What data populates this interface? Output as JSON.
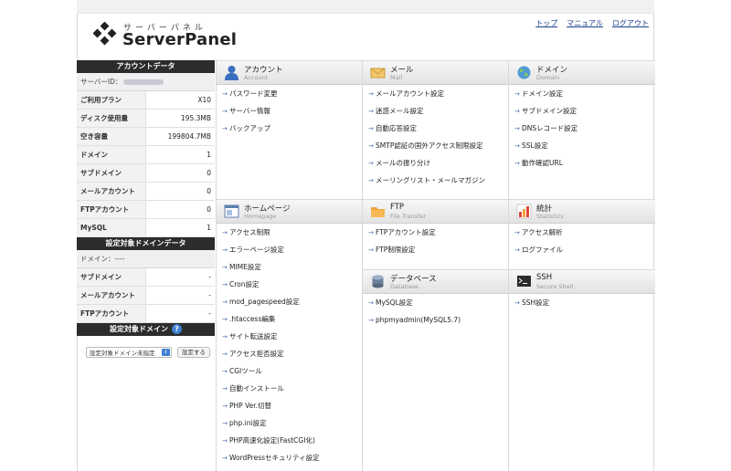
{
  "brand": {
    "kana": "サーバーパネル",
    "name": "ServerPanel"
  },
  "top_links": [
    "トップ",
    "マニュアル",
    "ログアウト"
  ],
  "account_data": {
    "title": "アカウントデータ",
    "server_id_label": "サーバーID：",
    "rows": [
      {
        "label": "ご利用プラン",
        "value": "X10"
      },
      {
        "label": "ディスク使用量",
        "value": "195.3MB"
      },
      {
        "label": "空き容量",
        "value": "199804.7MB"
      },
      {
        "label": "ドメイン",
        "value": "1"
      },
      {
        "label": "サブドメイン",
        "value": "0"
      },
      {
        "label": "メールアカウント",
        "value": "0"
      },
      {
        "label": "FTPアカウント",
        "value": "0"
      },
      {
        "label": "MySQL",
        "value": "1"
      }
    ]
  },
  "domain_data": {
    "title": "設定対象ドメインデータ",
    "domain_label": "ドメイン：----",
    "rows": [
      {
        "label": "サブドメイン",
        "value": "-"
      },
      {
        "label": "メールアカウント",
        "value": "-"
      },
      {
        "label": "FTPアカウント",
        "value": "-"
      }
    ]
  },
  "domain_select": {
    "title": "設定対象ドメイン",
    "help": "?",
    "selected": "設定対象ドメイン未指定",
    "button": "設定する"
  },
  "sections": {
    "account": {
      "title": "アカウント",
      "sub": "Account",
      "items": [
        "パスワード変更",
        "サーバー情報",
        "バックアップ"
      ]
    },
    "mail": {
      "title": "メール",
      "sub": "Mail",
      "items": [
        "メールアカウント設定",
        "迷惑メール設定",
        "自動応答設定",
        "SMTP認証の国外アクセス制限設定",
        "メールの振り分け",
        "メーリングリスト・メールマガジン"
      ]
    },
    "domain": {
      "title": "ドメイン",
      "sub": "Domain",
      "items": [
        "ドメイン設定",
        "サブドメイン設定",
        "DNSレコード設定",
        "SSL設定",
        "動作確認URL"
      ]
    },
    "homepage": {
      "title": "ホームページ",
      "sub": "Homepage",
      "items": [
        "アクセス制限",
        "エラーページ設定",
        "MIME設定",
        "Cron設定",
        "mod_pagespeed設定",
        ".htaccess編集",
        "サイト転送設定",
        "アクセス拒否設定",
        "CGIツール",
        "自動インストール",
        "PHP Ver.切替",
        "php.ini設定",
        "PHP高速化設定(FastCGI化)",
        "WordPressセキュリティ設定"
      ]
    },
    "ftp": {
      "title": "FTP",
      "sub": "File Transfer",
      "items": [
        "FTPアカウント設定",
        "FTP制限設定"
      ]
    },
    "stats": {
      "title": "統計",
      "sub": "Statistics",
      "items": [
        "アクセス解析",
        "ログファイル"
      ]
    },
    "database": {
      "title": "データベース",
      "sub": "Database",
      "items": [
        "MySQL設定",
        "phpmyadmin(MySQL5.7)"
      ]
    },
    "ssh": {
      "title": "SSH",
      "sub": "Secure Shell",
      "items": [
        "SSH設定"
      ]
    }
  },
  "colors": {
    "link": "#1a3f8a",
    "sidebar_header": "#2c2c2c",
    "arrow": "#4b6fa8",
    "help": "#3f7fd1"
  }
}
